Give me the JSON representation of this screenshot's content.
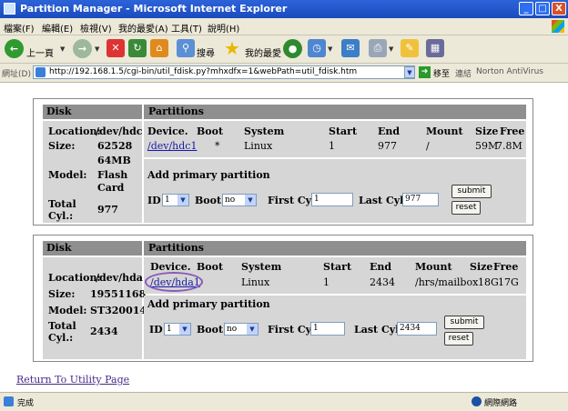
{
  "window": {
    "title": "Partition Manager - Microsoft Internet Explorer",
    "min": "_",
    "max": "□",
    "close": "X"
  },
  "menu": [
    "檔案(F)",
    "編輯(E)",
    "檢視(V)",
    "我的最愛(A)",
    "工具(T)",
    "說明(H)"
  ],
  "toolbar": {
    "back": "上一頁",
    "search": "搜尋",
    "favorites": "我的最愛"
  },
  "address": {
    "label": "網址(D)",
    "url": "http://192.168.1.5/cgi-bin/util_fdisk.py?mhxdfx=1&webPath=util_fdisk.htm",
    "go": "移至",
    "links": "連結",
    "norton": "Norton AntiVirus"
  },
  "disks": [
    {
      "disk_header": "Disk",
      "partitions_header": "Partitions",
      "location_label": "Location:",
      "location": "/dev/hdc",
      "size_label": "Size:",
      "size": "62528",
      "size_unit": "64MB",
      "model_label": "Model:",
      "model": "Flash",
      "model_line2": "Card",
      "total_label": "Total",
      "total_label2": "Cyl.:",
      "total": "977",
      "columns": [
        "Device.",
        "Boot",
        "System",
        "Start",
        "End",
        "Mount",
        "Size",
        "Free"
      ],
      "rows": [
        {
          "device": "/dev/hdc1",
          "boot": "*",
          "system": "Linux",
          "start": "1",
          "end": "977",
          "mount": "/",
          "size": "59M",
          "free": "7.8M"
        }
      ],
      "add_title": "Add primary partition",
      "id_label": "ID",
      "id_value": "1",
      "boot_label": "Boot",
      "boot_value": "no",
      "first_label": "First Cyl.",
      "first_value": "1",
      "last_label": "Last Cyl.",
      "last_value": "977",
      "submit": "submit",
      "reset": "reset"
    },
    {
      "disk_header": "Disk",
      "partitions_header": "Partitions",
      "location_label": "Location:",
      "location": "/dev/hda",
      "size_label": "Size:",
      "size": "19551168",
      "model_label": "Model:",
      "model": "ST320014A",
      "total_label": "Total",
      "total_label2": "Cyl.:",
      "total": "2434",
      "columns": [
        "Device.",
        "Boot",
        "System",
        "Start",
        "End",
        "Mount",
        "Size",
        "Free"
      ],
      "rows": [
        {
          "device": "/dev/hda1",
          "boot": "",
          "system": "Linux",
          "start": "1",
          "end": "2434",
          "mount": "/hrs/mailbox",
          "size": "18G",
          "free": "17G"
        }
      ],
      "add_title": "Add primary partition",
      "id_label": "ID",
      "id_value": "1",
      "boot_label": "Boot",
      "boot_value": "no",
      "first_label": "First Cyl.",
      "first_value": "1",
      "last_label": "Last Cyl.",
      "last_value": "2434",
      "submit": "submit",
      "reset": "reset"
    }
  ],
  "return_link": "Return To Utility Page",
  "status": {
    "left": "完成",
    "zone": "網際網路"
  },
  "colors": {
    "titlebar": "#2d63d9",
    "header": "#8f8f8f",
    "cell": "#d6d6d6",
    "link": "#1a1aa6",
    "highlight_circle": "#8a5ab8"
  }
}
